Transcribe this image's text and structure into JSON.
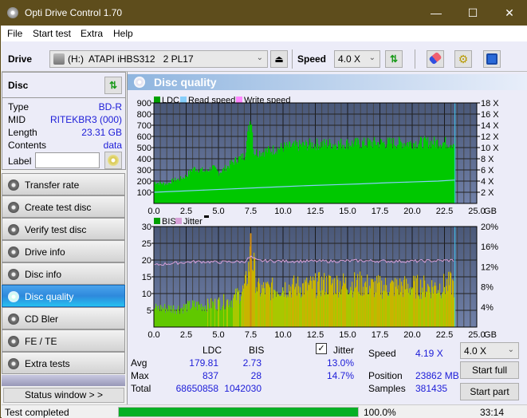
{
  "window": {
    "title": "Opti Drive Control 1.70",
    "minimize": "—",
    "maximize": "☐",
    "close": "✕"
  },
  "menu": [
    "File",
    "Start test",
    "Extra",
    "Help"
  ],
  "toolbar": {
    "drive_label": "Drive",
    "drive_value": "(H:)  ATAPI iHBS312   2 PL17",
    "speed_label": "Speed",
    "speed_value": "4.0 X",
    "icons": [
      "eject-icon",
      "refresh-icon",
      "erase-icon",
      "settings-icon",
      "save-icon"
    ]
  },
  "disc": {
    "header": "Disc",
    "rows": [
      {
        "label": "Type",
        "value": "BD-R"
      },
      {
        "label": "MID",
        "value": "RITEKBR3 (000)"
      },
      {
        "label": "Length",
        "value": "23.31 GB"
      },
      {
        "label": "Contents",
        "value": "data"
      }
    ],
    "label_field": {
      "label": "Label",
      "value": ""
    }
  },
  "nav": [
    {
      "label": "Transfer rate",
      "active": false
    },
    {
      "label": "Create test disc",
      "active": false
    },
    {
      "label": "Verify test disc",
      "active": false
    },
    {
      "label": "Drive info",
      "active": false
    },
    {
      "label": "Disc info",
      "active": false
    },
    {
      "label": "Disc quality",
      "active": true
    },
    {
      "label": "CD Bler",
      "active": false
    },
    {
      "label": "FE / TE",
      "active": false
    },
    {
      "label": "Extra tests",
      "active": false
    }
  ],
  "status_window_button": "Status window > >",
  "panel_title": "Disc quality",
  "chart_data": [
    {
      "type": "area",
      "title": "",
      "legend": [
        "LDC",
        "Read speed",
        "Write speed"
      ],
      "legend_colors": {
        "LDC": "#00a000",
        "Read speed": "#87cefa",
        "Write speed": "#ff88ff"
      },
      "xlabel": "GB",
      "ylabel": "",
      "xlim": [
        0,
        25
      ],
      "ylim": [
        0,
        900
      ],
      "y2lim": [
        0,
        18
      ],
      "x_ticks": [
        "0.0",
        "2.5",
        "5.0",
        "7.5",
        "10.0",
        "12.5",
        "15.0",
        "17.5",
        "20.0",
        "22.5",
        "25.0"
      ],
      "y_ticks": [
        "100",
        "200",
        "300",
        "400",
        "500",
        "600",
        "700",
        "800",
        "900"
      ],
      "y2_ticks": [
        "2 X",
        "4 X",
        "6 X",
        "8 X",
        "10 X",
        "12 X",
        "14 X",
        "16 X",
        "18 X"
      ],
      "grid": true,
      "ldc_series": {
        "x": [
          0,
          0.5,
          1,
          1.5,
          2,
          2.5,
          3,
          3.5,
          4,
          4.5,
          5,
          5.5,
          6,
          6.5,
          7,
          7.3,
          7.5,
          7.7,
          8,
          9,
          10,
          11,
          12,
          13,
          14,
          15,
          16,
          17,
          18,
          19,
          20,
          21,
          22,
          23,
          23.31
        ],
        "values": [
          200,
          190,
          185,
          220,
          230,
          260,
          330,
          320,
          300,
          340,
          290,
          330,
          380,
          420,
          450,
          700,
          837,
          480,
          480,
          500,
          530,
          540,
          555,
          560,
          560,
          565,
          565,
          570,
          570,
          570,
          570,
          575,
          575,
          570,
          575
        ]
      },
      "read_speed_series": {
        "x": [
          0,
          2,
          4,
          6,
          8,
          10,
          12,
          14,
          16,
          18,
          20,
          22,
          23.31
        ],
        "values": [
          2.0,
          2.2,
          2.4,
          2.6,
          2.8,
          3.0,
          3.2,
          3.35,
          3.5,
          3.7,
          3.85,
          4.0,
          4.19
        ]
      },
      "end_marker_gb": 23.31
    },
    {
      "type": "bar",
      "title": "",
      "legend": [
        "BIS",
        "Jitter"
      ],
      "legend_colors": {
        "BIS": "#00a000",
        "Jitter": "#d8a0d8"
      },
      "xlabel": "GB",
      "xlim": [
        0,
        25
      ],
      "ylim": [
        0,
        30
      ],
      "y2lim": [
        0,
        20
      ],
      "x_ticks": [
        "0.0",
        "2.5",
        "5.0",
        "7.5",
        "10.0",
        "12.5",
        "15.0",
        "17.5",
        "20.0",
        "22.5",
        "25.0"
      ],
      "y_ticks": [
        "5",
        "10",
        "15",
        "20",
        "25",
        "30"
      ],
      "y2_ticks": [
        "4%",
        "8%",
        "12%",
        "16%",
        "20%"
      ],
      "grid": true,
      "bis_series": {
        "x": [
          0,
          1,
          2,
          3,
          4,
          5,
          6,
          7,
          7.5,
          8,
          9,
          10,
          11,
          12,
          13,
          14,
          15,
          16,
          17,
          18,
          19,
          20,
          21,
          22,
          23,
          23.31
        ],
        "values": [
          7,
          7,
          7,
          8,
          8,
          9,
          10,
          14,
          28,
          14,
          14,
          15,
          15,
          15,
          16,
          16,
          16,
          16,
          15,
          15,
          15,
          15,
          15,
          15,
          16,
          15
        ]
      },
      "jitter_series": {
        "x": [
          0,
          1,
          2,
          3,
          4,
          5,
          6,
          7,
          7.5,
          8,
          10,
          12,
          14,
          16,
          18,
          20,
          22,
          23.31
        ],
        "values": [
          12.3,
          12.6,
          12.8,
          13.0,
          13.0,
          12.9,
          13.0,
          13.0,
          14.0,
          13.2,
          13.1,
          13.1,
          13.1,
          13.2,
          13.1,
          13.1,
          13.2,
          13.3
        ]
      },
      "end_marker_gb": 23.31
    }
  ],
  "stats": {
    "headers": [
      "LDC",
      "BIS"
    ],
    "jitter_label": "Jitter",
    "jitter_checked": true,
    "rows": [
      {
        "label": "Avg",
        "ldc": "179.81",
        "bis": "2.73",
        "jitter": "13.0%"
      },
      {
        "label": "Max",
        "ldc": "837",
        "bis": "28",
        "jitter": "14.7%"
      },
      {
        "label": "Total",
        "ldc": "68650858",
        "bis": "1042030",
        "jitter": ""
      }
    ],
    "speed_label": "Speed",
    "speed_value": "4.19 X",
    "position_label": "Position",
    "position_value": "23862 MB",
    "samples_label": "Samples",
    "samples_value": "381435",
    "speed_select": "4.0 X",
    "start_full": "Start full",
    "start_part": "Start part"
  },
  "status": {
    "text": "Test completed",
    "progress_percent": 100.0,
    "progress_label": "100.0%",
    "time": "33:14"
  }
}
